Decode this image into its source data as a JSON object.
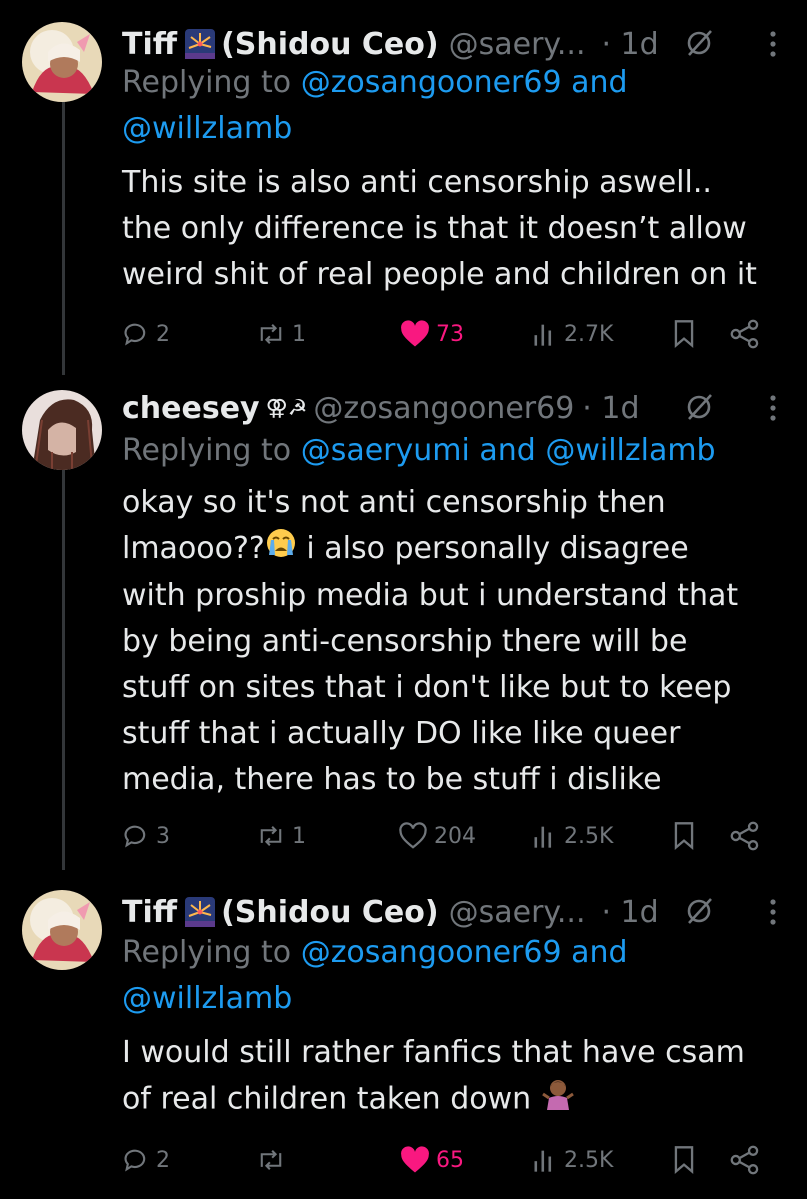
{
  "posts": [
    {
      "display_name": "Tiff",
      "display_name_suffix": "(Shidou Ceo)",
      "handle": "@saery...",
      "time": "· 1d",
      "reply_prefix": "Replying to",
      "reply_mentions": [
        "@zosangooner69",
        "and",
        "@willzlamb"
      ],
      "body_lines": [
        "This site is also anti censorship aswell..",
        "the only difference is that it doesn’t allow",
        "weird shit of real people and children on it"
      ],
      "actions": {
        "replies": "2",
        "reposts": "1",
        "likes": "73",
        "views": "2.7K"
      },
      "liked": true,
      "icons": [
        "reply-icon",
        "repost-icon",
        "heart-filled-icon",
        "views-icon",
        "bookmark-icon",
        "share-icon"
      ]
    },
    {
      "display_name": "cheesey",
      "display_name_suffix": "⚢☭",
      "handle": "@zosangooner69",
      "time": "· 1d",
      "reply_prefix": "Replying to",
      "reply_mentions": [
        "@saeryumi and @willzlamb"
      ],
      "body_lines": [
        "okay so it's not anti censorship then",
        "lmaooo??",
        " i also personally disagree",
        "with proship media but i understand that",
        "by being anti-censorship there will be",
        "stuff on sites that i don't like but to keep",
        "stuff that i actually DO like like queer",
        "media, there has to be stuff i dislike"
      ],
      "actions": {
        "replies": "3",
        "reposts": "1",
        "likes": "204",
        "views": "2.5K"
      },
      "liked": false,
      "icons": [
        "reply-icon",
        "repost-icon",
        "heart-outline-icon",
        "views-icon",
        "bookmark-icon",
        "share-icon"
      ]
    },
    {
      "display_name": "Tiff",
      "display_name_suffix": "(Shidou Ceo)",
      "handle": "@saery...",
      "time": "· 1d",
      "reply_prefix": "Replying to",
      "reply_mentions": [
        "@zosangooner69",
        "and",
        "@willzlamb"
      ],
      "body_lines": [
        "I would still rather fanfics that have csam",
        "of real children taken down"
      ],
      "actions": {
        "replies": "2",
        "reposts": "",
        "likes": "65",
        "views": "2.5K"
      },
      "liked": true,
      "icons": [
        "reply-icon",
        "repost-icon",
        "heart-filled-icon",
        "views-icon",
        "bookmark-icon",
        "share-icon"
      ]
    }
  ],
  "colors": {
    "background": "#000000",
    "text": "#e7e9ea",
    "secondary": "#71767b",
    "link": "#1d9bf0",
    "like": "#f91880",
    "thread_line": "#333639"
  }
}
